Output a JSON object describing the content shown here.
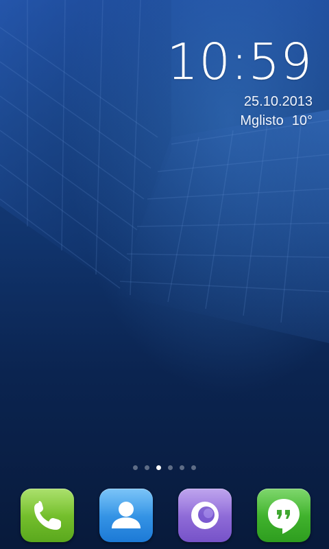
{
  "clock": {
    "time": "10:59",
    "date": "25.10.2013",
    "location": "Mglisto",
    "temperature": "10°"
  },
  "pages": {
    "count": 6,
    "active": 3
  },
  "dock": {
    "apps": [
      {
        "name": "phone",
        "icon": "phone-icon",
        "color": "#6bbf26"
      },
      {
        "name": "contacts",
        "icon": "contact-person-icon",
        "color": "#2a8ee6"
      },
      {
        "name": "browser",
        "icon": "browser-ring-icon",
        "color": "#8a66d8"
      },
      {
        "name": "hangouts",
        "icon": "hangouts-quote-icon",
        "color": "#3fb32b"
      }
    ]
  },
  "colors": {
    "wallpaper_top": "#1d4a9a",
    "wallpaper_bottom": "#081a3b",
    "clock_text": "#ffffff"
  }
}
